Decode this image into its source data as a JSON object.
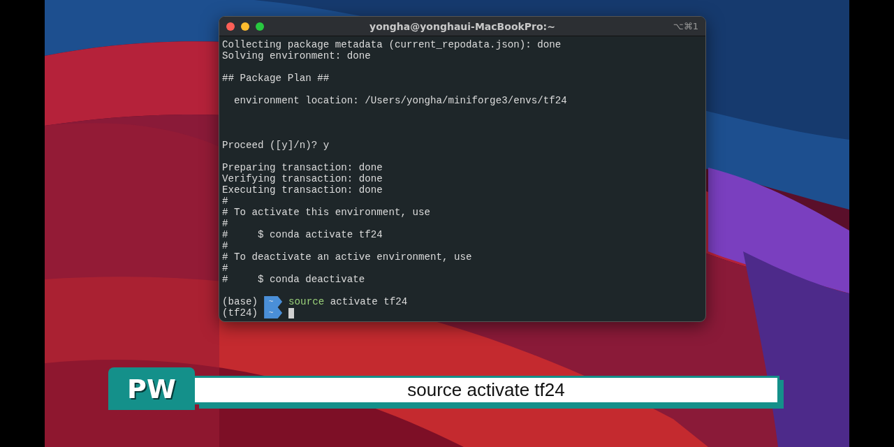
{
  "window": {
    "title": "yongha@yonghaui-MacBookPro:~",
    "shortcut": "⌥⌘1"
  },
  "terminal": {
    "blocks": [
      {
        "kind": "output",
        "lines": [
          "Collecting package metadata (current_repodata.json): done",
          "Solving environment: done"
        ]
      },
      {
        "kind": "output",
        "lines": [
          "## Package Plan ##"
        ]
      },
      {
        "kind": "output",
        "lines": [
          "  environment location: /Users/yongha/miniforge3/envs/tf24"
        ]
      },
      {
        "kind": "question",
        "lines": [
          "Proceed ([y]/n)? y"
        ]
      },
      {
        "kind": "output",
        "lines": [
          "Preparing transaction: done",
          "Verifying transaction: done",
          "Executing transaction: done",
          "#",
          "# To activate this environment, use",
          "#",
          "#     $ conda activate tf24",
          "#",
          "# To deactivate an active environment, use",
          "#",
          "#     $ conda deactivate"
        ]
      }
    ],
    "prompts": [
      {
        "env": "(base)",
        "dir": "~",
        "command": "source",
        "args": "activate tf24",
        "cursor": false
      },
      {
        "env": "(tf24)",
        "dir": "~",
        "cursor": true
      }
    ]
  },
  "caption": {
    "logo": "PW",
    "text": "source activate tf24"
  }
}
